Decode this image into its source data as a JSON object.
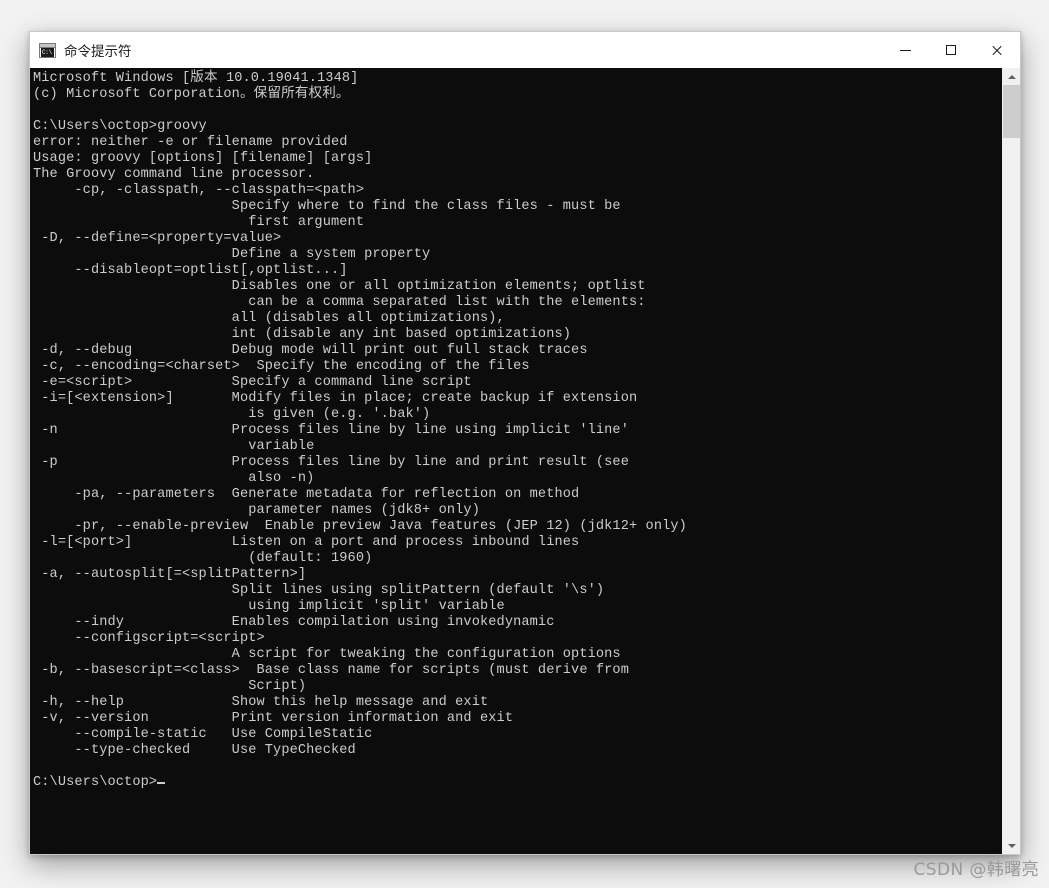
{
  "window": {
    "title": "命令提示符",
    "icon": "cmd-console-icon",
    "controls": {
      "minimize": "minimize-button",
      "maximize": "maximize-button",
      "close": "close-button"
    }
  },
  "console": {
    "background_color": "#0c0c0c",
    "foreground_color": "#cccccc",
    "prompt_path": "C:\\Users\\octop>",
    "command_entered": "groovy",
    "text": "Microsoft Windows [版本 10.0.19041.1348]\n(c) Microsoft Corporation。保留所有权利。\n\nC:\\Users\\octop>groovy\nerror: neither -e or filename provided\nUsage: groovy [options] [filename] [args]\nThe Groovy command line processor.\n     -cp, -classpath, --classpath=<path>\n                        Specify where to find the class files - must be\n                          first argument\n -D, --define=<property=value>\n                        Define a system property\n     --disableopt=optlist[,optlist...]\n                        Disables one or all optimization elements; optlist\n                          can be a comma separated list with the elements:\n                        all (disables all optimizations),\n                        int (disable any int based optimizations)\n -d, --debug            Debug mode will print out full stack traces\n -c, --encoding=<charset>  Specify the encoding of the files\n -e=<script>            Specify a command line script\n -i=[<extension>]       Modify files in place; create backup if extension\n                          is given (e.g. '.bak')\n -n                     Process files line by line using implicit 'line'\n                          variable\n -p                     Process files line by line and print result (see\n                          also -n)\n     -pa, --parameters  Generate metadata for reflection on method\n                          parameter names (jdk8+ only)\n     -pr, --enable-preview  Enable preview Java features (JEP 12) (jdk12+ only)\n -l=[<port>]            Listen on a port and process inbound lines\n                          (default: 1960)\n -a, --autosplit[=<splitPattern>]\n                        Split lines using splitPattern (default '\\s')\n                          using implicit 'split' variable\n     --indy             Enables compilation using invokedynamic\n     --configscript=<script>\n                        A script for tweaking the configuration options\n -b, --basescript=<class>  Base class name for scripts (must derive from\n                          Script)\n -h, --help             Show this help message and exit\n -v, --version          Print version information and exit\n     --compile-static   Use CompileStatic\n     --type-checked     Use TypeChecked\n\nC:\\Users\\octop>"
  },
  "scrollbar": {
    "up_arrow": "scroll-up-arrow",
    "down_arrow": "scroll-down-arrow",
    "thumb_position_percent": 1
  },
  "watermark": {
    "text": "CSDN @韩曙亮"
  }
}
